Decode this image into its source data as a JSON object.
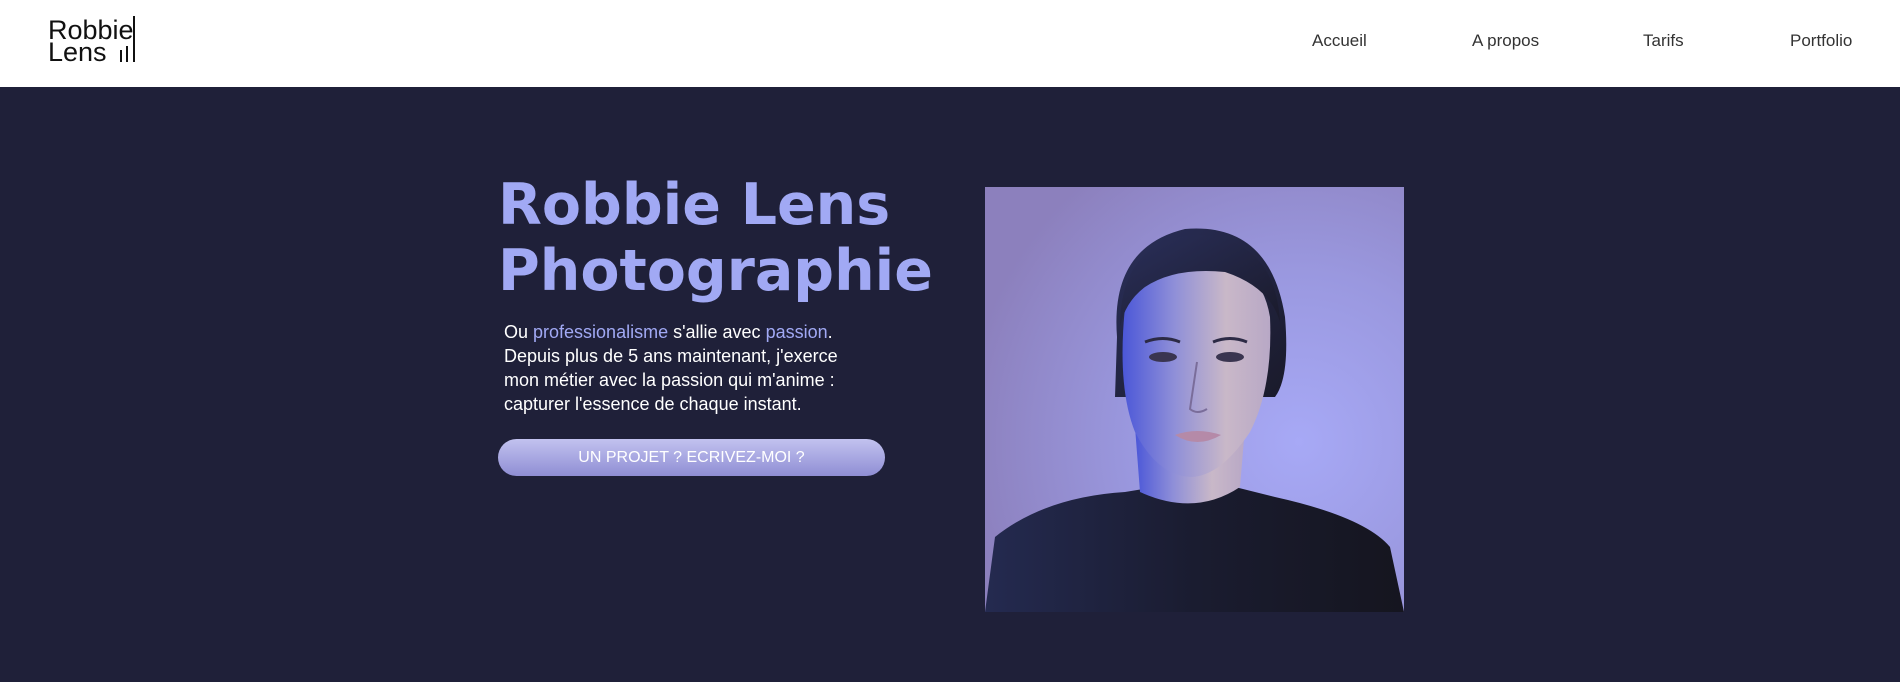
{
  "header": {
    "logo": {
      "line1": "Robbie",
      "line2": "Lens"
    },
    "nav": [
      {
        "label": "Accueil"
      },
      {
        "label": "A propos"
      },
      {
        "label": "Tarifs"
      },
      {
        "label": "Portfolio"
      }
    ]
  },
  "hero": {
    "title_line1": "Robbie Lens",
    "title_line2": "Photographie",
    "desc": {
      "part1": "Ou ",
      "accent1": "professionalisme",
      "part2": " s'allie avec ",
      "accent2": "passion",
      "part3": ".",
      "line2": "Depuis plus de 5 ans maintenant, j'exerce",
      "line3": "mon métier avec la passion qui m'anime :",
      "line4": "capturer l'essence de chaque instant."
    },
    "cta_label": "UN PROJET ? ECRIVEZ-MOI ?"
  },
  "colors": {
    "background": "#1f2039",
    "header_bg": "#ffffff",
    "accent": "#a1a9f4",
    "text": "#ffffff"
  }
}
